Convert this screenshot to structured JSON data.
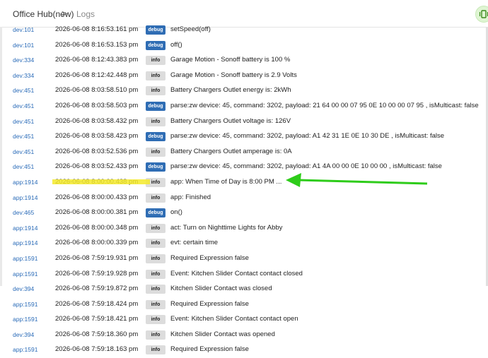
{
  "header": {
    "hub_name": "Office Hub(new)",
    "separator": ">",
    "section": "Logs"
  },
  "badges": {
    "debug": "debug",
    "info": "info"
  },
  "colors": {
    "debug_badge": "#2f6db4",
    "info_badge": "#dcdcdc",
    "device_link": "#2a6bb8",
    "highlight": "#f4ea2a",
    "arrow": "#2ecc1a"
  },
  "rows": [
    {
      "dev": "dev:101",
      "ts": "2026-06-08 8:16:53.161 pm",
      "level": "debug",
      "msg": "setSpeed(off)"
    },
    {
      "dev": "dev:101",
      "ts": "2026-06-08 8:16:53.153 pm",
      "level": "debug",
      "msg": "off()"
    },
    {
      "dev": "dev:334",
      "ts": "2026-06-08 8:12:43.383 pm",
      "level": "info",
      "msg": "Garage Motion - Sonoff battery is 100 %"
    },
    {
      "dev": "dev:334",
      "ts": "2026-06-08 8:12:42.448 pm",
      "level": "info",
      "msg": "Garage Motion - Sonoff battery is 2.9 Volts"
    },
    {
      "dev": "dev:451",
      "ts": "2026-06-08 8:03:58.510 pm",
      "level": "info",
      "msg": "Battery Chargers Outlet energy is: 2kWh"
    },
    {
      "dev": "dev:451",
      "ts": "2026-06-08 8:03:58.503 pm",
      "level": "debug",
      "msg": "parse:zw device: 45, command: 3202, payload: 21 64 00 00 07 95 0E 10 00 00 07 95 , isMulticast: false"
    },
    {
      "dev": "dev:451",
      "ts": "2026-06-08 8:03:58.432 pm",
      "level": "info",
      "msg": "Battery Chargers Outlet voltage is: 126V"
    },
    {
      "dev": "dev:451",
      "ts": "2026-06-08 8:03:58.423 pm",
      "level": "debug",
      "msg": "parse:zw device: 45, command: 3202, payload: A1 42 31 1E 0E 10 30 DE , isMulticast: false"
    },
    {
      "dev": "dev:451",
      "ts": "2026-06-08 8:03:52.536 pm",
      "level": "info",
      "msg": "Battery Chargers Outlet amperage is: 0A"
    },
    {
      "dev": "dev:451",
      "ts": "2026-06-08 8:03:52.433 pm",
      "level": "debug",
      "msg": "parse:zw device: 45, command: 3202, payload: A1 4A 00 00 0E 10 00 00 , isMulticast: false"
    },
    {
      "dev": "app:1914",
      "ts": "2026-06-08 8:00:00.438 pm",
      "level": "info",
      "msg": "app: When Time of Day is 8:00 PM ..."
    },
    {
      "dev": "app:1914",
      "ts": "2026-06-08 8:00:00.433 pm",
      "level": "info",
      "msg": "app: Finished"
    },
    {
      "dev": "dev:465",
      "ts": "2026-06-08 8:00:00.381 pm",
      "level": "debug",
      "msg": "on()"
    },
    {
      "dev": "app:1914",
      "ts": "2026-06-08 8:00:00.348 pm",
      "level": "info",
      "msg": "act: Turn on Nighttime Lights for Abby"
    },
    {
      "dev": "app:1914",
      "ts": "2026-06-08 8:00:00.339 pm",
      "level": "info",
      "msg": "evt: certain time"
    },
    {
      "dev": "app:1591",
      "ts": "2026-06-08 7:59:19.931 pm",
      "level": "info",
      "msg": "Required Expression false"
    },
    {
      "dev": "app:1591",
      "ts": "2026-06-08 7:59:19.928 pm",
      "level": "info",
      "msg": "Event: Kitchen Slider Contact contact closed"
    },
    {
      "dev": "dev:394",
      "ts": "2026-06-08 7:59:19.872 pm",
      "level": "info",
      "msg": "Kitchen Slider Contact was closed"
    },
    {
      "dev": "app:1591",
      "ts": "2026-06-08 7:59:18.424 pm",
      "level": "info",
      "msg": "Required Expression false"
    },
    {
      "dev": "app:1591",
      "ts": "2026-06-08 7:59:18.421 pm",
      "level": "info",
      "msg": "Event: Kitchen Slider Contact contact open"
    },
    {
      "dev": "dev:394",
      "ts": "2026-06-08 7:59:18.360 pm",
      "level": "info",
      "msg": "Kitchen Slider Contact was opened"
    },
    {
      "dev": "app:1591",
      "ts": "2026-06-08 7:59:18.163 pm",
      "level": "info",
      "msg": "Required Expression false"
    }
  ]
}
